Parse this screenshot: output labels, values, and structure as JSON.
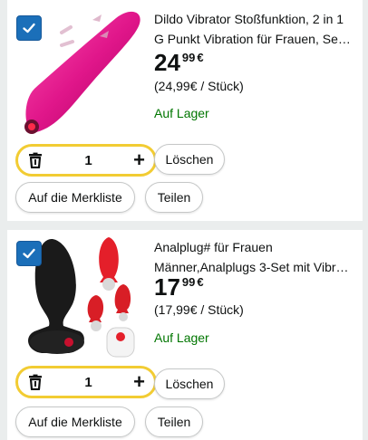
{
  "cart_items": [
    {
      "title_line1": "Dildo Vibrator Stoßfunktion, 2 in 1",
      "title_line2": "G Punkt Vibration für Frauen, Se…",
      "price_whole": "24",
      "price_fraction": "99",
      "currency": "€",
      "unit_price": "(24,99€ / Stück)",
      "stock": "Auf Lager",
      "quantity": "1",
      "selected": true
    },
    {
      "title_line1": "Analplug# für Frauen",
      "title_line2": "Männer,Analplugs 3-Set mit Vibr…",
      "price_whole": "17",
      "price_fraction": "99",
      "currency": "€",
      "unit_price": "(17,99€ / Stück)",
      "stock": "Auf Lager",
      "quantity": "1",
      "selected": true
    }
  ],
  "buttons": {
    "delete": "Löschen",
    "wishlist": "Auf die Merkliste",
    "share": "Teilen"
  },
  "colors": {
    "accent_yellow": "#f2cc33",
    "checkbox_blue": "#1b6fb9",
    "in_stock_green": "#007600"
  },
  "icons": [
    "checkmark-icon",
    "trash-icon",
    "plus-icon"
  ]
}
